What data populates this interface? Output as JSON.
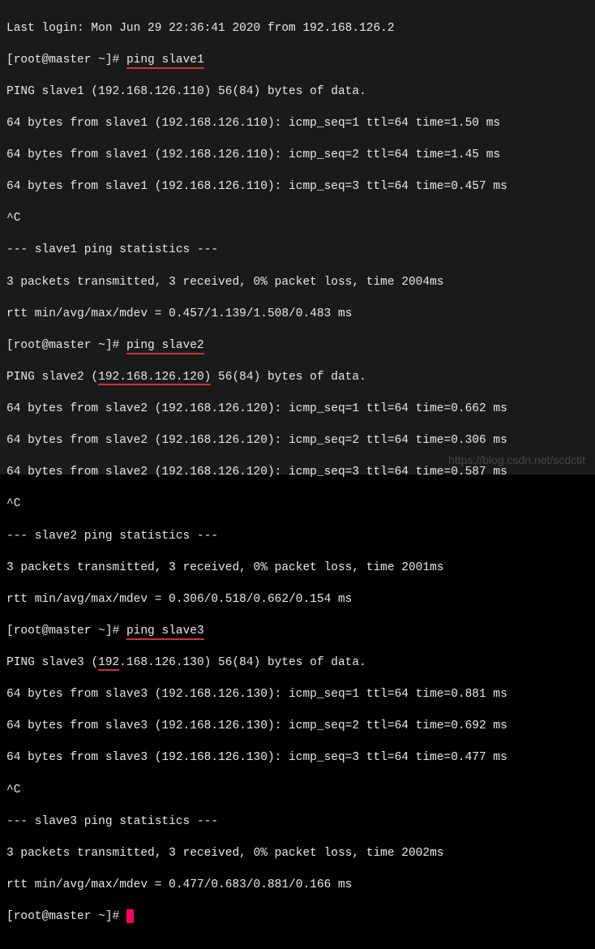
{
  "lastLogin": "Last login: Mon Jun 29 22:36:41 2020 from 192.168.126.2",
  "promptPrefix": "[root@master ~]# ",
  "sessions": [
    {
      "cmd": "ping slave1",
      "header": "PING slave1 (192.168.126.110) 56(84) bytes of data.",
      "replies": [
        "64 bytes from slave1 (192.168.126.110): icmp_seq=1 ttl=64 time=1.50 ms",
        "64 bytes from slave1 (192.168.126.110): icmp_seq=2 ttl=64 time=1.45 ms",
        "64 bytes from slave1 (192.168.126.110): icmp_seq=3 ttl=64 time=0.457 ms"
      ],
      "interrupt": "^C",
      "statsHeader": "--- slave1 ping statistics ---",
      "statsSummary": "3 packets transmitted, 3 received, 0% packet loss, time 2004ms",
      "statsRtt": "rtt min/avg/max/mdev = 0.457/1.139/1.508/0.483 ms"
    },
    {
      "cmd": "ping slave2",
      "header": "PING slave2 (192.168.126.120) 56(84) bytes of data.",
      "replies": [
        "64 bytes from slave2 (192.168.126.120): icmp_seq=1 ttl=64 time=0.662 ms",
        "64 bytes from slave2 (192.168.126.120): icmp_seq=2 ttl=64 time=0.306 ms",
        "64 bytes from slave2 (192.168.126.120): icmp_seq=3 ttl=64 time=0.587 ms"
      ],
      "interrupt": "^C",
      "statsHeader": "--- slave2 ping statistics ---",
      "statsSummary": "3 packets transmitted, 3 received, 0% packet loss, time 2001ms",
      "statsRtt": "rtt min/avg/max/mdev = 0.306/0.518/0.662/0.154 ms"
    },
    {
      "cmd": "ping slave3",
      "header": "PING slave3 (192.168.126.130) 56(84) bytes of data.",
      "replies": [
        "64 bytes from slave3 (192.168.126.130): icmp_seq=1 ttl=64 time=0.881 ms",
        "64 bytes from slave3 (192.168.126.130): icmp_seq=2 ttl=64 time=0.692 ms",
        "64 bytes from slave3 (192.168.126.130): icmp_seq=3 ttl=64 time=0.477 ms"
      ],
      "interrupt": "^C",
      "statsHeader": "--- slave3 ping statistics ---",
      "statsSummary": "3 packets transmitted, 3 received, 0% packet loss, time 2002ms",
      "statsRtt": "rtt min/avg/max/mdev = 0.477/0.683/0.881/0.166 ms"
    }
  ],
  "watermark": "https://blog.csdn.net/scdctit"
}
